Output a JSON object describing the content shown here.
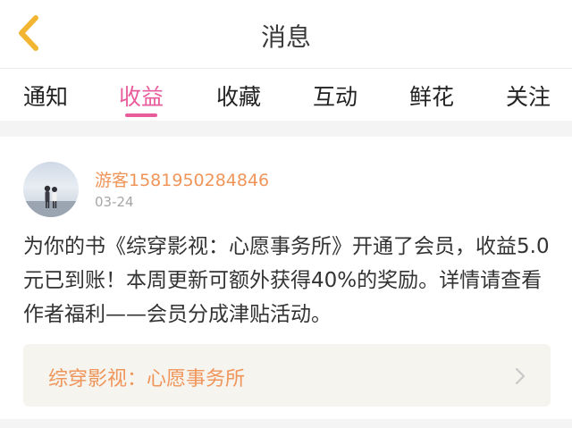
{
  "header": {
    "title": "消息",
    "back_icon": "chevron-left-icon",
    "back_color": "#f2b531"
  },
  "tabs": [
    {
      "label": "通知",
      "active": false
    },
    {
      "label": "收益",
      "active": true
    },
    {
      "label": "收藏",
      "active": false
    },
    {
      "label": "互动",
      "active": false
    },
    {
      "label": "鲜花",
      "active": false
    },
    {
      "label": "关注",
      "active": false
    }
  ],
  "accent_color": "#e95c9b",
  "message": {
    "username": "游客1581950284846",
    "date": "03-24",
    "text": "为你的书《综穿影视：心愿事务所》开通了会员，收益5.0元已到账！本周更新可额外获得40%的奖励。详情请查看作者福利——会员分成津贴活动。",
    "book": {
      "title": "综穿影视：心愿事务所",
      "arrow_icon": "chevron-right-icon"
    }
  }
}
